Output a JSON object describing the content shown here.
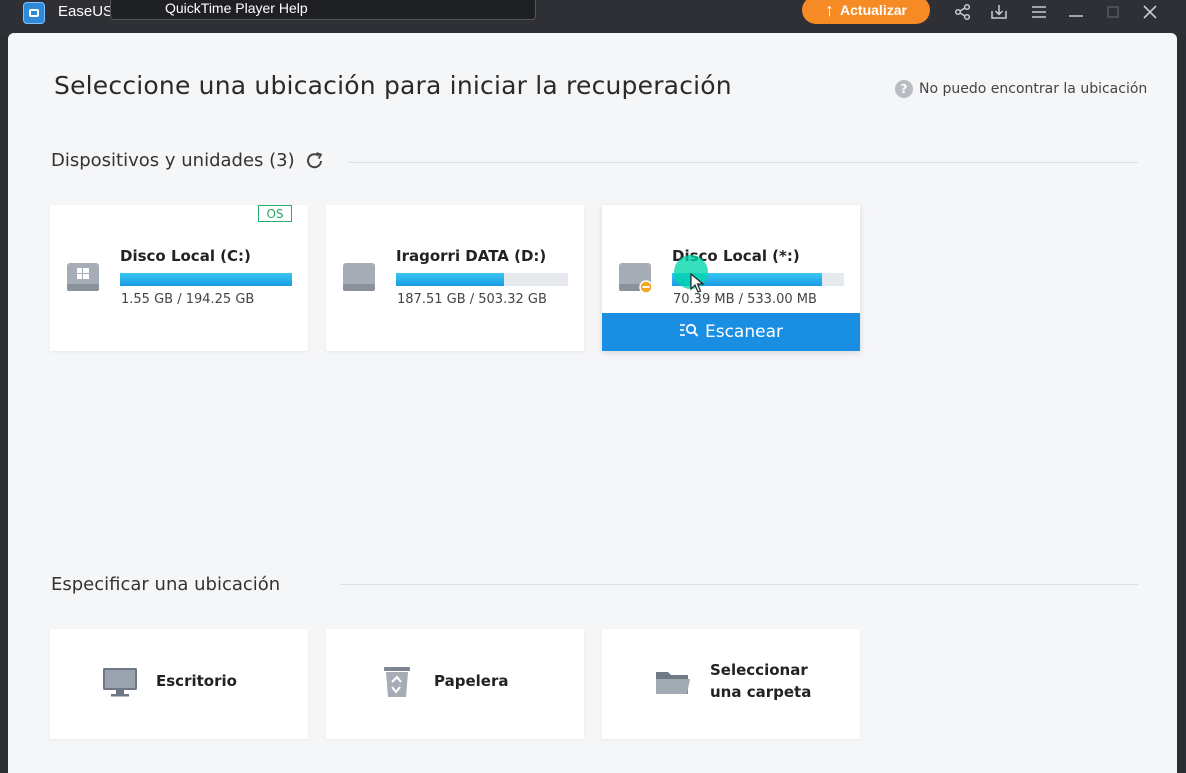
{
  "window": {
    "app_name": "EaseUS",
    "tooltip": "QuickTime Player Help",
    "upgrade_label": "Actualizar",
    "icons": [
      "share-icon",
      "download-icon",
      "menu-icon",
      "minimize-icon",
      "maximize-icon",
      "close-icon"
    ]
  },
  "header": {
    "title": "Seleccione una ubicación para iniciar la recuperación",
    "help_link": "No puedo encontrar la ubicación"
  },
  "devices": {
    "section_title": "Dispositivos y unidades (3)",
    "drives": [
      {
        "name": "Disco Local (C:)",
        "size": "1.55 GB / 194.25 GB",
        "used_fraction": 1.0,
        "badge": "OS",
        "type": "windows-drive-icon"
      },
      {
        "name": "Iragorri DATA (D:)",
        "size": "187.51 GB / 503.32 GB",
        "used_fraction": 0.63,
        "type": "drive-icon"
      },
      {
        "name": "Disco Local (*:)",
        "size": "70.39 MB / 533.00 MB",
        "used_fraction": 0.87,
        "type": "drive-warning-icon",
        "scan_label": "Escanear"
      }
    ]
  },
  "locations": {
    "section_title": "Especificar una ubicación",
    "items": [
      {
        "label": "Escritorio",
        "icon": "desktop-icon"
      },
      {
        "label": "Papelera",
        "icon": "recycle-bin-icon"
      },
      {
        "label_line1": "Seleccionar",
        "label_line2": "una carpeta",
        "icon": "folder-icon"
      }
    ]
  },
  "colors": {
    "accent": "#1a8ee3",
    "upgrade": "#f68b25",
    "os_badge": "#27a862",
    "cursor_highlight": "#00d6aa"
  }
}
